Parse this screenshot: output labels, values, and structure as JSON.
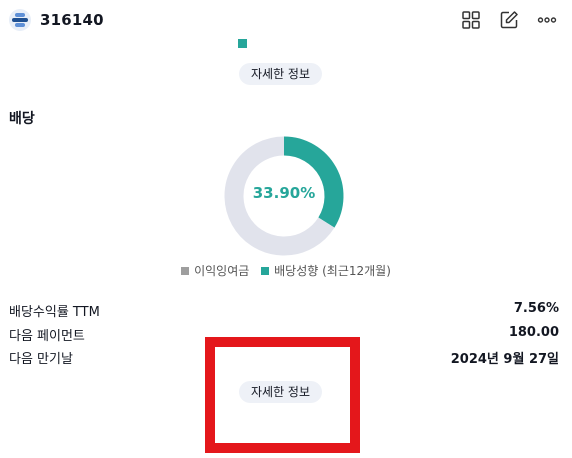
{
  "header": {
    "ticker": "316140",
    "icons": [
      "grid-icon",
      "edit-icon",
      "more-icon"
    ]
  },
  "top_more_button": "자세한 정보",
  "dividend": {
    "section_title": "배당",
    "payout_ratio_label": "33.90%",
    "legend": [
      {
        "label": "이익잉여금",
        "color": "#9e9e9e"
      },
      {
        "label": "배당성향 (최근12개월)",
        "color": "#26a69a"
      }
    ],
    "rows": [
      {
        "label": "배당수익률 TTM",
        "value": "7.56%"
      },
      {
        "label": "다음 페이먼트",
        "value": "180.00"
      },
      {
        "label": "다음 만기날",
        "value": "2024년 9월 27일"
      }
    ],
    "more_button": "자세한 정보"
  },
  "chart_data": {
    "type": "pie",
    "series": [
      {
        "name": "배당성향 (최근12개월)",
        "value": 33.9,
        "color": "#26a69a"
      },
      {
        "name": "이익잉여금",
        "value": 66.1,
        "color": "#e1e3ec"
      }
    ]
  },
  "colors": {
    "accent": "#26a69a",
    "highlight_box": "#e4171b",
    "pill_bg": "#eef1f7"
  }
}
